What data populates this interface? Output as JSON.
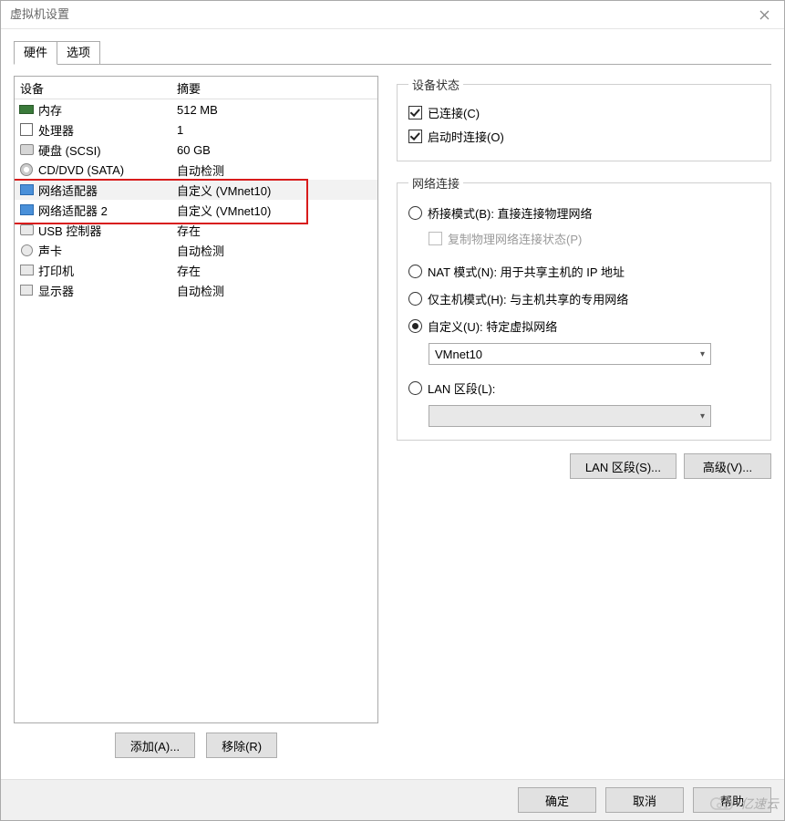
{
  "window": {
    "title": "虚拟机设置"
  },
  "tabs": {
    "hardware": "硬件",
    "options": "选项"
  },
  "device_table": {
    "col_device": "设备",
    "col_summary": "摘要",
    "rows": [
      {
        "icon": "memory-icon",
        "name": "内存",
        "summary": "512 MB"
      },
      {
        "icon": "cpu-icon",
        "name": "处理器",
        "summary": "1"
      },
      {
        "icon": "hdd-icon",
        "name": "硬盘 (SCSI)",
        "summary": "60 GB"
      },
      {
        "icon": "cd-icon",
        "name": "CD/DVD (SATA)",
        "summary": "自动检测"
      },
      {
        "icon": "network-icon",
        "name": "网络适配器",
        "summary": "自定义 (VMnet10)"
      },
      {
        "icon": "network-icon",
        "name": "网络适配器 2",
        "summary": "自定义 (VMnet10)"
      },
      {
        "icon": "usb-icon",
        "name": "USB 控制器",
        "summary": "存在"
      },
      {
        "icon": "sound-icon",
        "name": "声卡",
        "summary": "自动检测"
      },
      {
        "icon": "printer-icon",
        "name": "打印机",
        "summary": "存在"
      },
      {
        "icon": "display-icon",
        "name": "显示器",
        "summary": "自动检测"
      }
    ]
  },
  "buttons": {
    "add": "添加(A)...",
    "remove": "移除(R)",
    "lan_segments": "LAN 区段(S)...",
    "advanced": "高级(V)...",
    "ok": "确定",
    "cancel": "取消",
    "help": "帮助"
  },
  "status_group": {
    "legend": "设备状态",
    "connected": "已连接(C)",
    "connect_at_poweron": "启动时连接(O)"
  },
  "net_group": {
    "legend": "网络连接",
    "bridged": "桥接模式(B): 直接连接物理网络",
    "replicate": "复制物理网络连接状态(P)",
    "nat": "NAT 模式(N): 用于共享主机的 IP 地址",
    "hostonly": "仅主机模式(H): 与主机共享的专用网络",
    "custom": "自定义(U): 特定虚拟网络",
    "custom_value": "VMnet10",
    "lan_segment": "LAN 区段(L):",
    "lan_segment_value": ""
  },
  "watermark": "亿速云"
}
